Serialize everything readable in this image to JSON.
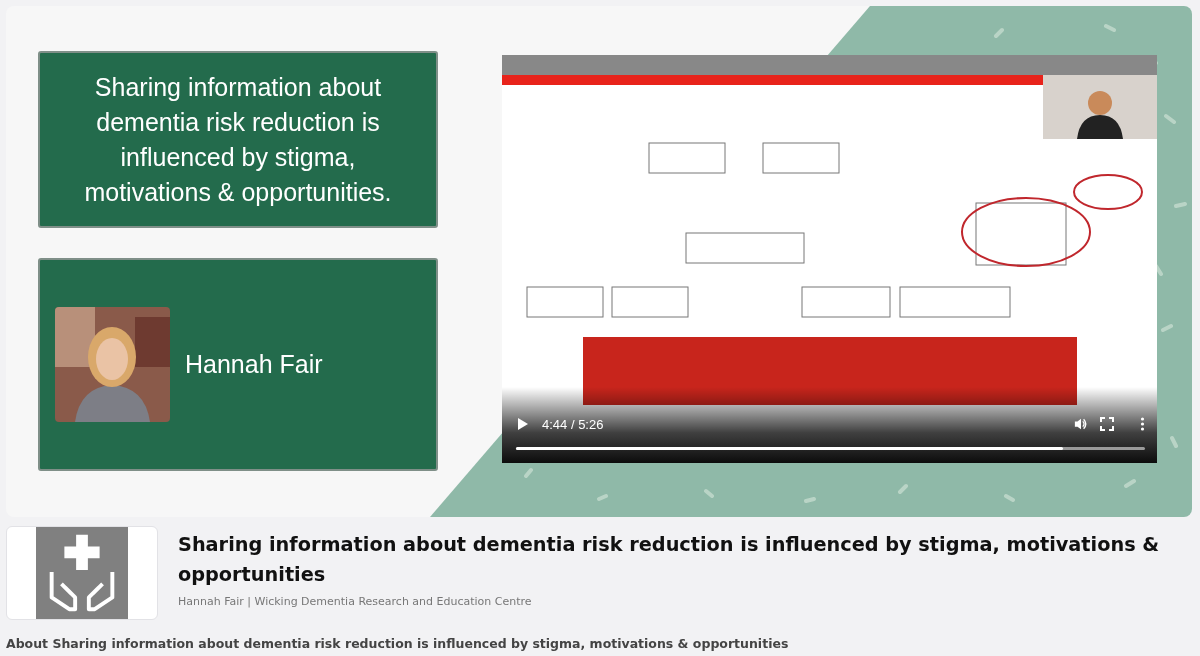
{
  "banner": {
    "title_card": "Sharing information about dementia risk reduction is influenced by stigma, motivations & opportunities.",
    "presenter_card": {
      "name": "Hannah Fair"
    }
  },
  "video": {
    "time": "4:44 / 5:26",
    "progress": {
      "level": 0.87
    }
  },
  "details": {
    "title": "Sharing information about dementia risk reduction is influenced by stigma, motivations & opportunities",
    "byline": "Hannah Fair | Wicking Dementia Research and Education Centre"
  },
  "about": "About Sharing information about dementia risk reduction is influenced by stigma, motivations & opportunities"
}
